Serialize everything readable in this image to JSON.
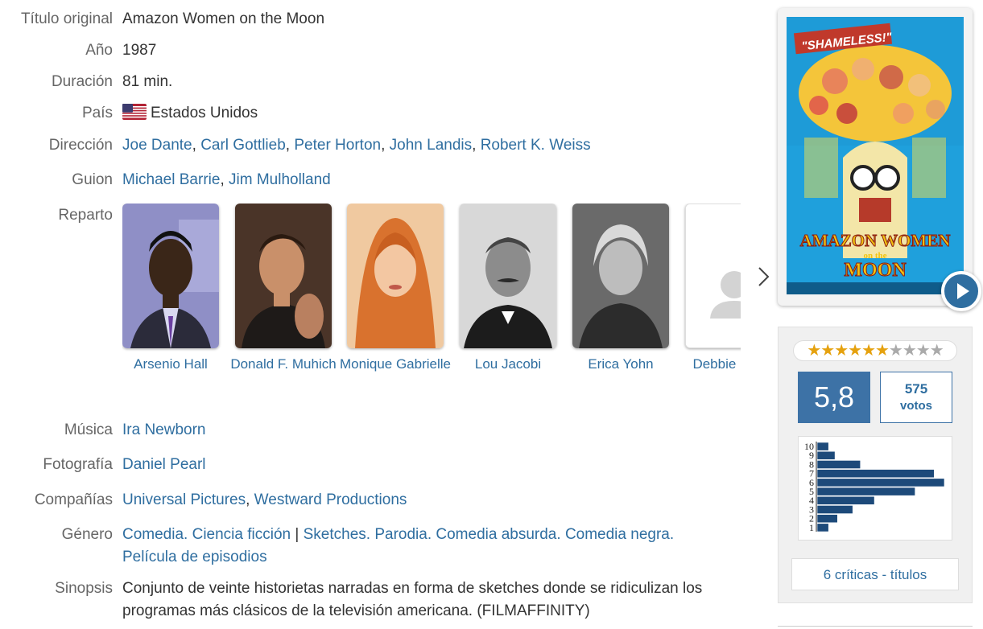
{
  "fields": {
    "original_title": {
      "label": "Título original",
      "value": "Amazon Women on the Moon"
    },
    "year": {
      "label": "Año",
      "value": "1987"
    },
    "duration": {
      "label": "Duración",
      "value": "81 min."
    },
    "country": {
      "label": "País",
      "value": "Estados Unidos",
      "icon": "us-flag-icon"
    },
    "direction": {
      "label": "Dirección",
      "names": [
        "Joe Dante",
        "Carl Gottlieb",
        "Peter Horton",
        "John Landis",
        "Robert K. Weiss"
      ],
      "separator": ", "
    },
    "screenplay": {
      "label": "Guion",
      "names": [
        "Michael Barrie",
        "Jim Mulholland"
      ],
      "separator": ", "
    },
    "cast": {
      "label": "Reparto"
    },
    "music": {
      "label": "Música",
      "names": [
        "Ira Newborn"
      ]
    },
    "photography": {
      "label": "Fotografía",
      "names": [
        "Daniel Pearl"
      ]
    },
    "companies": {
      "label": "Compañías",
      "names": [
        "Universal Pictures",
        "Westward Productions"
      ],
      "separator": ", "
    },
    "genre": {
      "label": "Género",
      "items": [
        "Comedia",
        "Ciencia ficción",
        "|",
        "Sketches",
        "Parodia",
        "Comedia absurda",
        "Comedia negra",
        "Película de episodios"
      ]
    },
    "synopsis": {
      "label": "Sinopsis",
      "value": "Conjunto de veinte historietas narradas en forma de sketches donde se ridiculizan los programas más clásicos de la televisión americana. (FILMAFFINITY)"
    }
  },
  "cast": [
    {
      "name": "Arsenio Hall"
    },
    {
      "name": "Donald F. Muhich"
    },
    {
      "name": "Monique Gabrielle"
    },
    {
      "name": "Lou Jacobi"
    },
    {
      "name": "Erica Yohn"
    },
    {
      "name": "Debbie Davis"
    }
  ],
  "poster": {
    "tagline": "\"SHAMELESS!\"",
    "title_line1": "AMAZON WOMEN",
    "title_line2": "on the",
    "title_line3": "MOON"
  },
  "rating": {
    "stars_filled": 6,
    "stars_total": 10,
    "average": "5,8",
    "votes_count": "575",
    "votes_label": "votos",
    "colors": {
      "accent": "#3d72a6",
      "link": "#2f6ea0",
      "star": "#e5a10e"
    },
    "histogram": {
      "scores": [
        "10",
        "9",
        "8",
        "7",
        "6",
        "5",
        "4",
        "3",
        "2",
        "1"
      ],
      "relative": [
        0.09,
        0.14,
        0.34,
        0.92,
        1.0,
        0.77,
        0.45,
        0.28,
        0.16,
        0.09
      ]
    },
    "critics_link": "6 críticas - títulos"
  }
}
